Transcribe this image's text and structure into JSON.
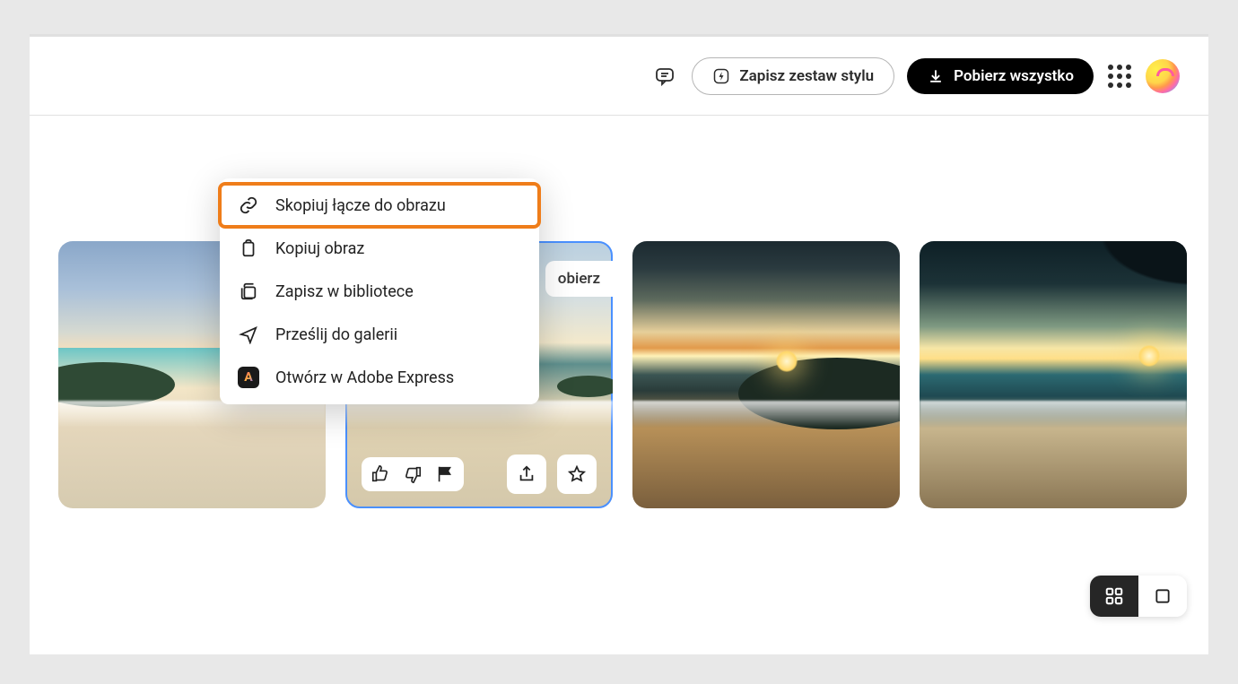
{
  "header": {
    "save_style_label": "Zapisz zestaw stylu",
    "download_all_label": "Pobierz wszystko"
  },
  "gallery": {
    "download_chip": "obierz"
  },
  "context_menu": {
    "copy_link": "Skopiuj łącze do obrazu",
    "copy_image": "Kopiuj obraz",
    "save_library": "Zapisz w bibliotece",
    "send_gallery": "Prześlij do galerii",
    "open_express": "Otwórz w Adobe Express"
  }
}
